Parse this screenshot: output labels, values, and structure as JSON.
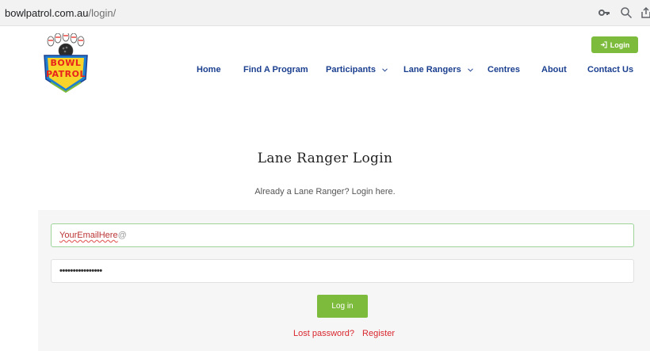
{
  "browser": {
    "url_domain": "bowlpatrol.com.au",
    "url_path": "/login/",
    "icons": [
      "key-icon",
      "zoom-icon",
      "share-icon"
    ]
  },
  "header": {
    "logo": {
      "line1": "BOWL",
      "line2": "PATROL"
    },
    "login_button": {
      "label": "Login",
      "icon": "sign-in-icon"
    },
    "nav": [
      {
        "label": "Home",
        "dropdown": false
      },
      {
        "label": "Find A Program",
        "dropdown": false
      },
      {
        "label": "Participants",
        "dropdown": true
      },
      {
        "label": "Lane Rangers",
        "dropdown": true
      },
      {
        "label": "Centres",
        "dropdown": false
      },
      {
        "label": "About",
        "dropdown": false
      },
      {
        "label": "Contact Us",
        "dropdown": false
      }
    ]
  },
  "main": {
    "title": "Lane Ranger Login",
    "subtitle": "Already a Lane Ranger? Login here.",
    "form": {
      "email_value_underlined": "YourEmailHere",
      "email_value_rest": "@",
      "password_value": "••••••••••••••••",
      "submit_label": "Log in"
    },
    "links": {
      "lost_password": "Lost password?",
      "register": "Register"
    }
  },
  "colors": {
    "accent_green": "#7dbb3c",
    "nav_blue": "#1b3f8f",
    "link_red": "#d9262e"
  }
}
